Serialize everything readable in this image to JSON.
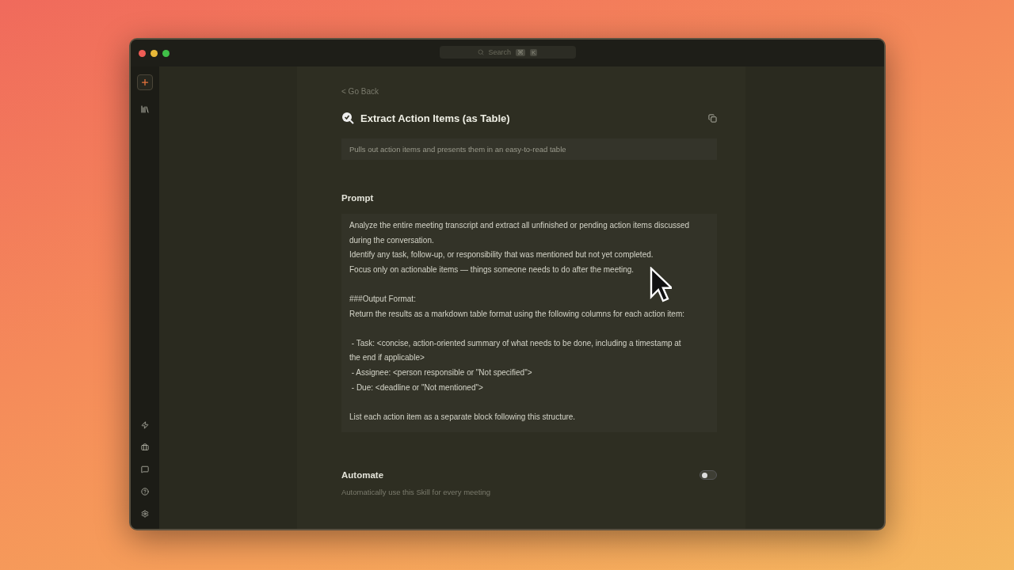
{
  "window": {
    "search": {
      "placeholder": "Search",
      "shortcut": [
        "⌘",
        "K"
      ]
    }
  },
  "sidebar": {
    "top": [
      {
        "kind": "new"
      },
      {
        "kind": "library"
      }
    ],
    "bottom": [
      {
        "kind": "bolt"
      },
      {
        "kind": "briefcase"
      },
      {
        "kind": "chat"
      },
      {
        "kind": "help"
      },
      {
        "kind": "settings"
      }
    ]
  },
  "back_link": "< Go Back",
  "skill": {
    "title": "Extract Action Items (as Table)",
    "description": "Pulls out action items and presents them in an easy-to-read table"
  },
  "prompt": {
    "heading": "Prompt",
    "text": "Analyze the entire meeting transcript and extract all unfinished or pending action items discussed during the conversation.\nIdentify any task, follow-up, or responsibility that was mentioned but not yet completed.\nFocus only on actionable items — things someone needs to do after the meeting.\n\n###Output Format:\nReturn the results as a markdown table format using the following columns for each action item:\n\n - Task: <concise, action-oriented summary of what needs to be done, including a timestamp at the end if applicable>\n - Assignee: <person responsible or \"Not specified\">\n - Due: <deadline or \"Not mentioned\">\n\nList each action item as a separate block following this structure."
  },
  "automate": {
    "heading": "Automate",
    "description": "Automatically use this Skill for every meeting",
    "on": false
  }
}
